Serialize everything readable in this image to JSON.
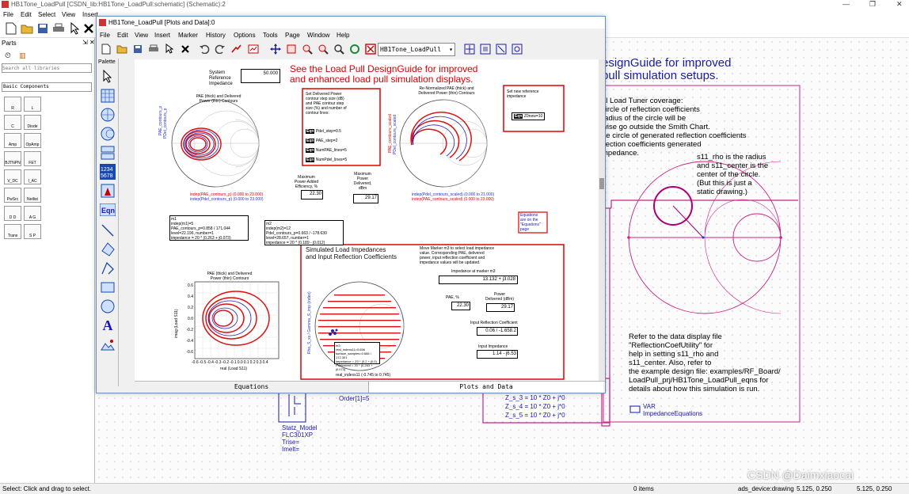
{
  "main_window": {
    "title": "HB1Tone_LoadPull [CSDN_lib:HB1Tone_LoadPull:schematic] (Schematic):2",
    "menu": [
      "File",
      "Edit",
      "Select",
      "View",
      "Insert"
    ]
  },
  "parts_panel": {
    "title": "Parts",
    "search_placeholder": "Search all libraries",
    "library": "Basic Components",
    "items": [
      "R",
      "L",
      "C",
      "Diode",
      "Amp",
      "OpAmp",
      "BJTNPN",
      "FET",
      "V_DC",
      "I_AC",
      "PwSrc",
      "Netlist",
      "D D",
      "A G",
      "Trans",
      "S P"
    ]
  },
  "data_window": {
    "title": "HB1Tone_LoadPull [Plots and Data]:0",
    "menu": [
      "File",
      "Edit",
      "View",
      "Insert",
      "Marker",
      "History",
      "Options",
      "Tools",
      "Page",
      "Window",
      "Help"
    ],
    "dataset": "HB1Tone_LoadPull",
    "palette_title": "Palette"
  },
  "canvas": {
    "headline_1": "See the Load Pull DesignGuide for improved",
    "headline_2": "and enhanced load pull simulation displays.",
    "sys_ref_label_1": "System",
    "sys_ref_label_2": "Reference",
    "sys_ref_label_3": "Impedance",
    "sys_ref_value": "50.000",
    "chart1_title_1": "PAE (thick) and Delivered",
    "chart1_title_2": "Power (thin) Contours",
    "chart1_ylabel": "PAE_contours_p",
    "chart1_ylabel2": "PDel_contours_p",
    "chart1_foot_1": "indep(PAE_contours_p) (0.000 to 23.000)",
    "chart1_foot_2": "indep(Pdel_contours_p) (0.000 to 23.000)",
    "setbox_1": "Set Delivered Power",
    "setbox_2": "contour step size (dB)",
    "setbox_3": "and PAE contour step",
    "setbox_4": "size (%) and number of",
    "setbox_5": "contour lines:",
    "eq1": "Pdel_step=0.5",
    "eq2": "PAE_step=2",
    "eq3": "NumPAE_lines=5",
    "eq4": "NumPdel_lines=5",
    "eqn_tag": "Eqn",
    "chart2_title_1": "Re-Normalized PAE (thick) and",
    "chart2_title_2": "Delivered Power (thin) Contours",
    "chart2_ylabel": "PAE_contours_scaled",
    "chart2_ylabel2": "PDel_contours_scaled",
    "chart2_foot_1": "indep(Pdel_contours_scaled) (0.000 to 21.000)",
    "chart2_foot_2": "indep(PAE_contours_scaled) (0.000 to 23.000)",
    "newref_1": "Set new reference",
    "newref_2": "impedance",
    "newref_eq": "Z0new=10",
    "maxpae_1": "Maximum",
    "maxpae_2": "Power-Added",
    "maxpae_3": "Efficiency, %",
    "maxpae_value": "22.30",
    "maxpow_1": "Maximum",
    "maxpow_2": "Power",
    "maxpow_3": "Delivered,",
    "maxpow_4": "dBm",
    "maxpow_value": "29.17",
    "eqnote_1": "Equations",
    "eqnote_2": "are on the",
    "eqnote_3": "\"Equations\"",
    "eqnote_4": "page",
    "m1_1": "m1",
    "m1_2": "indep(m1)=5",
    "m1_3": "PAE_contours_p=0.858 / 171.044",
    "m1_4": "level=22.196, number=1",
    "m1_5": "impedance = 20 * (0.263 + j0.073)",
    "m2_1": "m2",
    "m2_2": "indep(m2)=12",
    "m2_3": "Pdel_contours_p=0.663 / -178.630",
    "m2_4": "level=28.657, number=1",
    "m2_5": "impedance = 20 * (0.189 - j0.012)",
    "chart3_title_1": "PAE (thick) and Delivered",
    "chart3_title_2": "Power (thin) Contours",
    "chart3_ylabel": "imag (Load S11)",
    "chart3_xlabel": "real (Load S11)",
    "chart3_yticks": [
      "0.6",
      "0.4",
      "0.2",
      "0.0",
      "-0.2",
      "-0.4",
      "-0.6"
    ],
    "chart3_xticks": [
      "-0.6",
      "-0.5",
      "-0.4",
      "-0.3",
      "-0.2",
      "-0.1",
      "0.0",
      "0.1",
      "0.2",
      "0.3",
      "0.4"
    ],
    "sim_title_1": "Simulated Load Impedances",
    "sim_title_2": "and Input Reflection Coefficients",
    "move_1": "Move Marker m3 to select load impedance",
    "move_2": "value.  Corresponding PAE, delivered",
    "move_3": "power, input reflection coefficient and",
    "move_4": "impedance values will be updated.",
    "imp_m3_label": "Impedance at marker m3",
    "imp_m3_value": "13.132 + j3.028",
    "pae_label": "PAE, %",
    "pae_value": "22.30",
    "pow_label_1": "Power",
    "pow_label_2": "Delivered (dBm)",
    "pow_value": "29.17",
    "irc_label": "Input Reflection Coefficient",
    "irc_value": "0.06 / -1.658.2",
    "inimp_label": "Input Impedance",
    "inimp_value": "1.14 - j6.53",
    "chart4_ylabel": "Rho_S_xs / Gamma_S_imp (index)",
    "chart4_foot": "real_indexs11 (-0.745 to 0.745)",
    "m3_1": "m3",
    "m3_2": "real_indexs11=0.656",
    "m3_3": "surface_samples=0.686 / 172.301",
    "m3_4": "impedance = Z0 * (0.2 + j0.0)",
    "m3_5": "Pdelivered = 20 * (0.263 + j0.073)"
  },
  "tabs": [
    "Equations",
    "Plots and Data"
  ],
  "schematic": {
    "heading_1": "esignGuide for improved",
    "heading_2": "pull simulation setups.",
    "coverage_1": "al Load Tuner coverage:",
    "coverage_2": "circle of reflection coefficients",
    "coverage_3": "radius of the circle will be",
    "coverage_4": "wise go outside the Smith Chart.",
    "coverage_5": "he circle of generated reflection coefficients",
    "coverage_6": "flection coefficients generated",
    "coverage_7": "mpedance.",
    "note_1": "s11_rho is the radius",
    "note_2": "and s11_center is the",
    "note_3": "center of the circle.",
    "note_4": "(But this is just a",
    "note_5": "static drawing.)",
    "refer_1": "Refer to the data display file",
    "refer_2": "\"ReflectionCoefUtility\" for",
    "refer_3": "help in setting s11_rho and",
    "refer_4": "s11_center.  Also, refer to",
    "refer_5": "the example design file: examples/RF_Board/",
    "refer_6": "LoadPull_prj/HB1Tone_LoadPull_eqns for",
    "refer_7": "details about how this simulation is run.",
    "order": "Order[1]=5",
    "zs_3": "Z_s_3 = 10 * Z0 + j*0",
    "zs_4": "Z_s_4 = 10 * Z0 + j*0",
    "zs_5": "Z_s_5 = 10 * Z0 + j*0",
    "var_1": "VAR",
    "var_2": "ImpedanceEquations",
    "statz_1": "Statz_Model",
    "statz_2": "FLC301XP",
    "statz_3": "Trise=",
    "statz_4": "Imelt="
  },
  "status": {
    "left": "Select: Click and drag to select.",
    "items": "0 items",
    "mode": "ads_device:drawing",
    "coord1": "5.125, 0.250",
    "coord2": "5.125, 0.250",
    "watermark": "CSDN @Daimxiaocai"
  },
  "colors": {
    "pae_contour": "#dd1111",
    "pdel_contour": "#2222bb",
    "schematic_pink": "#cc2288",
    "accent_red": "#dd0000"
  }
}
